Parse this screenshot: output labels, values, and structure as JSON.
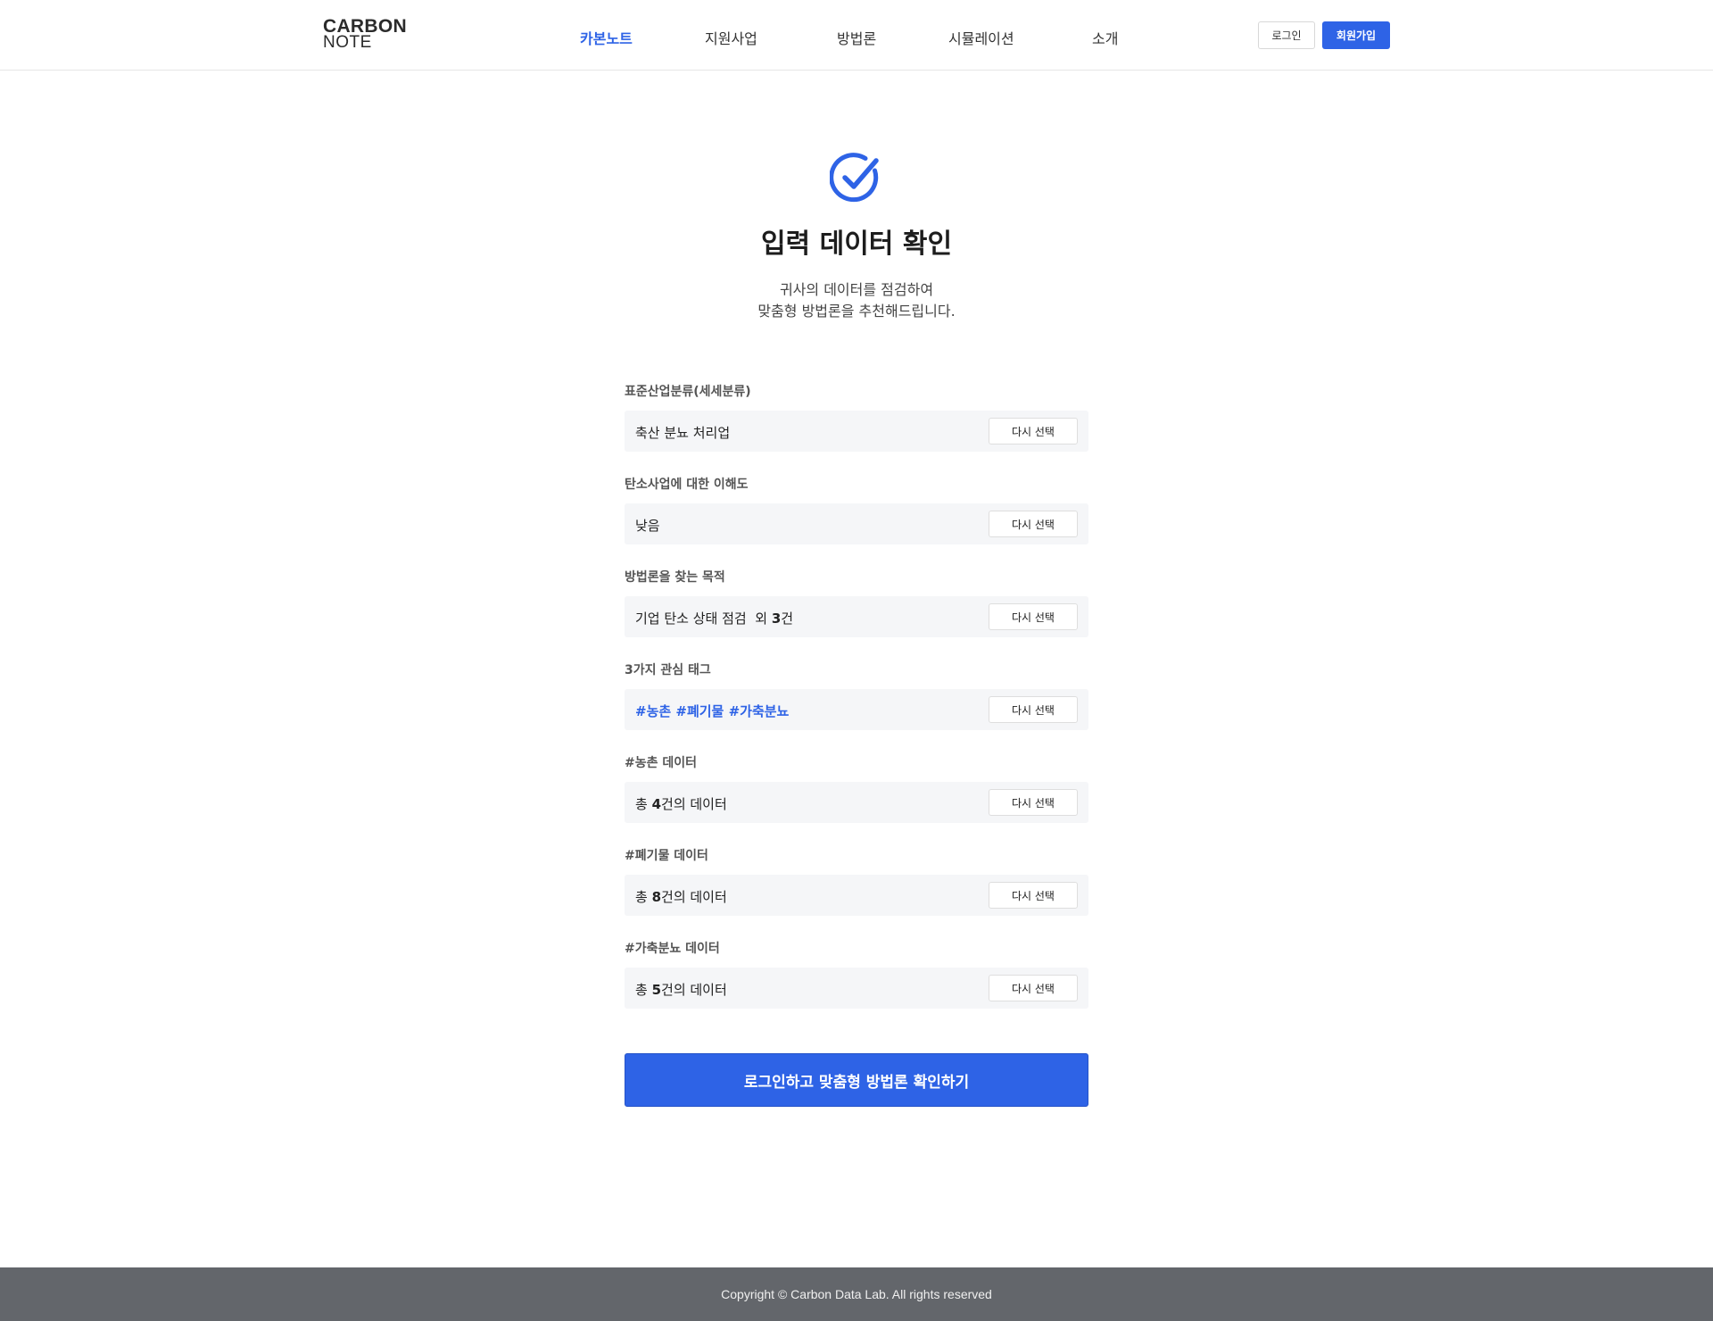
{
  "logo": {
    "line1": "CARBON",
    "line2": "NOTE"
  },
  "nav": {
    "items": [
      {
        "label": "카본노트",
        "active": true
      },
      {
        "label": "지원사업"
      },
      {
        "label": "방법론"
      },
      {
        "label": "시뮬레이션"
      },
      {
        "label": "소개"
      }
    ]
  },
  "auth": {
    "login": "로그인",
    "signup": "회원가입"
  },
  "hero": {
    "title": "입력 데이터 확인",
    "subtitle_line1": "귀사의 데이터를 점검하여",
    "subtitle_line2": "맞춤형 방법론을 추천해드립니다."
  },
  "fields": [
    {
      "label": "표준산업분류(세세분류)",
      "value": "축산 분뇨 처리업",
      "button": "다시 선택"
    },
    {
      "label": "탄소사업에 대한 이해도",
      "value": "낮음",
      "button": "다시 선택"
    },
    {
      "label": "방법론을 찾는 목적",
      "value_prefix": "기업 탄소 상태 점검  외 ",
      "value_num": "3",
      "value_suffix": "건",
      "button": "다시 선택"
    },
    {
      "label": "3가지 관심 태그",
      "value": "#농촌 #폐기물 #가축분뇨",
      "button": "다시 선택"
    },
    {
      "label": "#농촌 데이터",
      "value_prefix": "총 ",
      "value_num": "4",
      "value_suffix": "건의 데이터",
      "button": "다시 선택"
    },
    {
      "label": "#폐기물 데이터",
      "value_prefix": "총 ",
      "value_num": "8",
      "value_suffix": "건의 데이터",
      "button": "다시 선택"
    },
    {
      "label": "#가축분뇨 데이터",
      "value_prefix": "총 ",
      "value_num": "5",
      "value_suffix": "건의 데이터",
      "button": "다시 선택"
    }
  ],
  "cta": {
    "label": "로그인하고 맞춤형 방법론 확인하기"
  },
  "footer": {
    "copyright": "Copyright © Carbon Data Lab. All rights reserved"
  },
  "colors": {
    "accent": "#2e63e6",
    "footer_bg": "#63666b",
    "field_bg": "#f5f6f8"
  },
  "icons": {
    "hero": "check-circle-icon"
  }
}
